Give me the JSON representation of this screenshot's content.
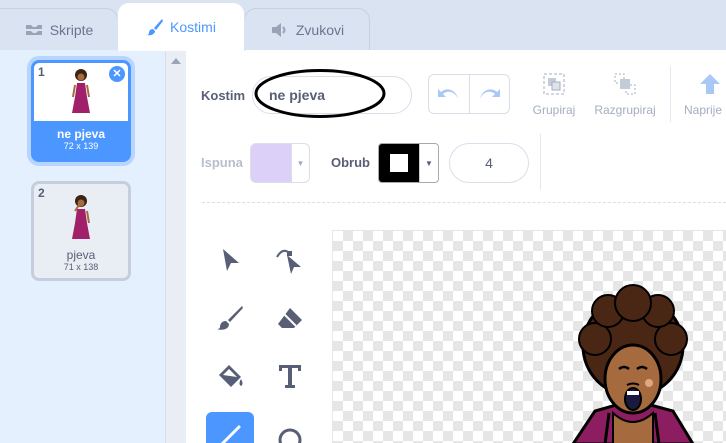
{
  "tabs": [
    {
      "label": "Skripte",
      "icon": "code-icon"
    },
    {
      "label": "Kostimi",
      "icon": "paintbrush-icon"
    },
    {
      "label": "Zvukovi",
      "icon": "speaker-icon"
    }
  ],
  "costumes": [
    {
      "number": "1",
      "name": "ne pjeva",
      "size": "72 x 139",
      "selected": true
    },
    {
      "number": "2",
      "name": "pjeva",
      "size": "71 x 138",
      "selected": false
    }
  ],
  "editor": {
    "costume_label": "Kostim",
    "costume_name": "ne pjeva",
    "group_label": "Grupiraj",
    "ungroup_label": "Razgrupiraj",
    "forward_label": "Naprije",
    "fill_label": "Ispuna",
    "fill_color": "#dccff8",
    "outline_label": "Obrub",
    "outline_color": "#000000",
    "outline_width": "4"
  },
  "tools": [
    "select-icon",
    "reshape-icon",
    "brush-icon",
    "eraser-icon",
    "fill-icon",
    "text-icon",
    "line-icon",
    "circle-icon"
  ],
  "colors": {
    "accent": "#4c97ff",
    "background": "#e5f0ff"
  }
}
